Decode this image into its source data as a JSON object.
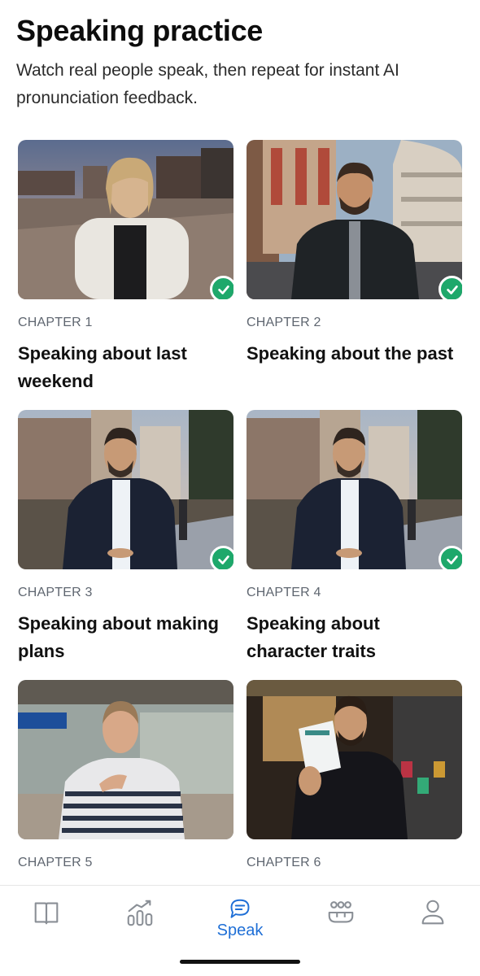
{
  "header": {
    "title": "Speaking practice",
    "subtitle": "Watch real people speak, then repeat for instant AI pronunciation feedback."
  },
  "chapters": [
    {
      "chapter": "CHAPTER 1",
      "title": "Speaking about last weekend",
      "completed": true
    },
    {
      "chapter": "CHAPTER 2",
      "title": "Speaking about the past",
      "completed": true
    },
    {
      "chapter": "CHAPTER 3",
      "title": "Speaking about making plans",
      "completed": true
    },
    {
      "chapter": "CHAPTER 4",
      "title": "Speaking about character traits",
      "completed": true
    },
    {
      "chapter": "CHAPTER 5",
      "title": "",
      "completed": false
    },
    {
      "chapter": "CHAPTER 6",
      "title": "",
      "completed": false
    }
  ],
  "tabbar": {
    "tabs": [
      {
        "id": "library",
        "icon": "book-icon",
        "label": ""
      },
      {
        "id": "progress",
        "icon": "chart-icon",
        "label": ""
      },
      {
        "id": "speak",
        "icon": "chat-icon",
        "label": "Speak",
        "active": true
      },
      {
        "id": "community",
        "icon": "people-icon",
        "label": ""
      },
      {
        "id": "profile",
        "icon": "user-icon",
        "label": ""
      }
    ]
  },
  "colors": {
    "accent": "#1f6fd6",
    "check": "#1ea86b",
    "inactive_icon": "#8a8f96"
  }
}
